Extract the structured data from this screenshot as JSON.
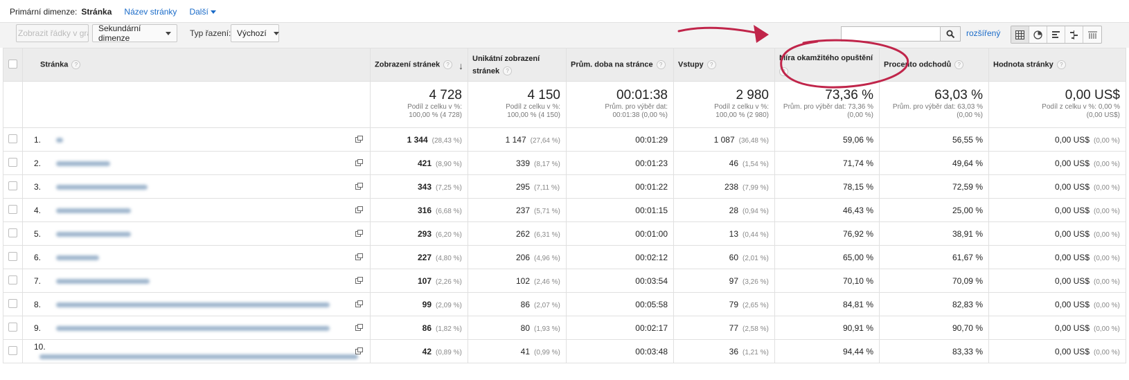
{
  "dimension": {
    "label": "Primární dimenze:",
    "active": "Stránka",
    "options": [
      "Název stránky",
      "Další"
    ]
  },
  "toolbar": {
    "plot_rows": "Zobrazit řádky v grafu",
    "secondary_dimension": "Sekundární dimenze",
    "sort_label": "Typ řazení:",
    "sort_value": "Výchozí",
    "search_value": "",
    "advanced": "rozšířený"
  },
  "columns": {
    "page": "Stránka",
    "pageviews": "Zobrazení stránek",
    "unique_pageviews": "Unikátní zobrazení stránek",
    "avg_time": "Prům. doba na stránce",
    "entrances": "Vstupy",
    "bounce_rate": "Míra okamžitého opuštění",
    "exit_rate": "Procento odchodů",
    "page_value": "Hodnota stránky"
  },
  "summary": {
    "pageviews": {
      "value": "4 728",
      "sub1": "Podíl z celku v %:",
      "sub2": "100,00 % (4 728)"
    },
    "unique_pageviews": {
      "value": "4 150",
      "sub1": "Podíl z celku v %:",
      "sub2": "100,00 % (4 150)"
    },
    "avg_time": {
      "value": "00:01:38",
      "sub1": "Prům. pro výběr dat:",
      "sub2": "00:01:38 (0,00 %)"
    },
    "entrances": {
      "value": "2 980",
      "sub1": "Podíl z celku v %:",
      "sub2": "100,00 % (2 980)"
    },
    "bounce_rate": {
      "value": "73,36 %",
      "sub1": "Prům. pro výběr dat: 73,36 %",
      "sub2": "(0,00 %)"
    },
    "exit_rate": {
      "value": "63,03 %",
      "sub1": "Prům. pro výběr dat: 63,03 %",
      "sub2": "(0,00 %)"
    },
    "page_value": {
      "value": "0,00 US$",
      "sub1": "Podíl z celku v %: 0,00 %",
      "sub2": "(0,00 US$)"
    }
  },
  "rows": [
    {
      "idx": "1.",
      "pv": "1 344",
      "pv_pct": "(28,43 %)",
      "upv": "1 147",
      "upv_pct": "(27,64 %)",
      "time": "00:01:29",
      "ent": "1 087",
      "ent_pct": "(36,48 %)",
      "bounce": "59,06 %",
      "exit": "56,55 %",
      "val": "0,00 US$",
      "val_pct": "(0,00 %)"
    },
    {
      "idx": "2.",
      "pv": "421",
      "pv_pct": "(8,90 %)",
      "upv": "339",
      "upv_pct": "(8,17 %)",
      "time": "00:01:23",
      "ent": "46",
      "ent_pct": "(1,54 %)",
      "bounce": "71,74 %",
      "exit": "49,64 %",
      "val": "0,00 US$",
      "val_pct": "(0,00 %)"
    },
    {
      "idx": "3.",
      "pv": "343",
      "pv_pct": "(7,25 %)",
      "upv": "295",
      "upv_pct": "(7,11 %)",
      "time": "00:01:22",
      "ent": "238",
      "ent_pct": "(7,99 %)",
      "bounce": "78,15 %",
      "exit": "72,59 %",
      "val": "0,00 US$",
      "val_pct": "(0,00 %)"
    },
    {
      "idx": "4.",
      "pv": "316",
      "pv_pct": "(6,68 %)",
      "upv": "237",
      "upv_pct": "(5,71 %)",
      "time": "00:01:15",
      "ent": "28",
      "ent_pct": "(0,94 %)",
      "bounce": "46,43 %",
      "exit": "25,00 %",
      "val": "0,00 US$",
      "val_pct": "(0,00 %)"
    },
    {
      "idx": "5.",
      "pv": "293",
      "pv_pct": "(6,20 %)",
      "upv": "262",
      "upv_pct": "(6,31 %)",
      "time": "00:01:00",
      "ent": "13",
      "ent_pct": "(0,44 %)",
      "bounce": "76,92 %",
      "exit": "38,91 %",
      "val": "0,00 US$",
      "val_pct": "(0,00 %)"
    },
    {
      "idx": "6.",
      "pv": "227",
      "pv_pct": "(4,80 %)",
      "upv": "206",
      "upv_pct": "(4,96 %)",
      "time": "00:02:12",
      "ent": "60",
      "ent_pct": "(2,01 %)",
      "bounce": "65,00 %",
      "exit": "61,67 %",
      "val": "0,00 US$",
      "val_pct": "(0,00 %)"
    },
    {
      "idx": "7.",
      "pv": "107",
      "pv_pct": "(2,26 %)",
      "upv": "102",
      "upv_pct": "(2,46 %)",
      "time": "00:03:54",
      "ent": "97",
      "ent_pct": "(3,26 %)",
      "bounce": "70,10 %",
      "exit": "70,09 %",
      "val": "0,00 US$",
      "val_pct": "(0,00 %)"
    },
    {
      "idx": "8.",
      "pv": "99",
      "pv_pct": "(2,09 %)",
      "upv": "86",
      "upv_pct": "(2,07 %)",
      "time": "00:05:58",
      "ent": "79",
      "ent_pct": "(2,65 %)",
      "bounce": "84,81 %",
      "exit": "82,83 %",
      "val": "0,00 US$",
      "val_pct": "(0,00 %)"
    },
    {
      "idx": "9.",
      "pv": "86",
      "pv_pct": "(1,82 %)",
      "upv": "80",
      "upv_pct": "(1,93 %)",
      "time": "00:02:17",
      "ent": "77",
      "ent_pct": "(2,58 %)",
      "bounce": "90,91 %",
      "exit": "90,70 %",
      "val": "0,00 US$",
      "val_pct": "(0,00 %)"
    },
    {
      "idx": "10.",
      "pv": "42",
      "pv_pct": "(0,89 %)",
      "upv": "41",
      "upv_pct": "(0,99 %)",
      "time": "00:03:48",
      "ent": "36",
      "ent_pct": "(1,21 %)",
      "bounce": "94,44 %",
      "exit": "83,33 %",
      "val": "0,00 US$",
      "val_pct": "(0,00 %)"
    }
  ],
  "annotation_color": "#c0254a",
  "link_color": "#1a6bc8"
}
